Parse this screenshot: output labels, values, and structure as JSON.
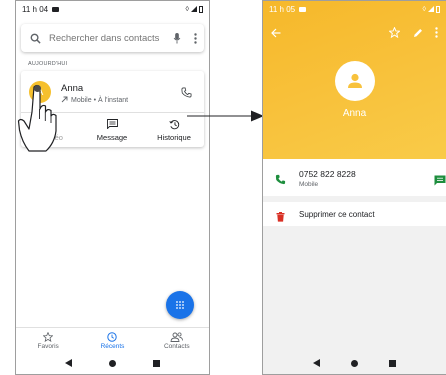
{
  "left_screen": {
    "status": {
      "time": "11 h 04"
    },
    "search": {
      "placeholder": "Rechercher dans contacts"
    },
    "section_label": "AUJOURD'HUI",
    "call": {
      "avatar_letter": "A",
      "name": "Anna",
      "detail": "Mobile • À l'instant",
      "actions": [
        {
          "label": "el vidéo"
        },
        {
          "label": "Message"
        },
        {
          "label": "Historique"
        }
      ]
    },
    "nav": [
      {
        "label": "Favoris"
      },
      {
        "label": "Récents"
      },
      {
        "label": "Contacts"
      }
    ]
  },
  "right_screen": {
    "status": {
      "time": "11 h 05"
    },
    "contact_name": "Anna",
    "phone": {
      "number": "0752 822 8228",
      "type": "Mobile"
    },
    "delete_label": "Supprimer ce contact"
  },
  "colors": {
    "accent": "#1a73e8",
    "header_yellow": "#f8c23c",
    "call_green": "#1e8e3e",
    "delete_red": "#d93025"
  }
}
